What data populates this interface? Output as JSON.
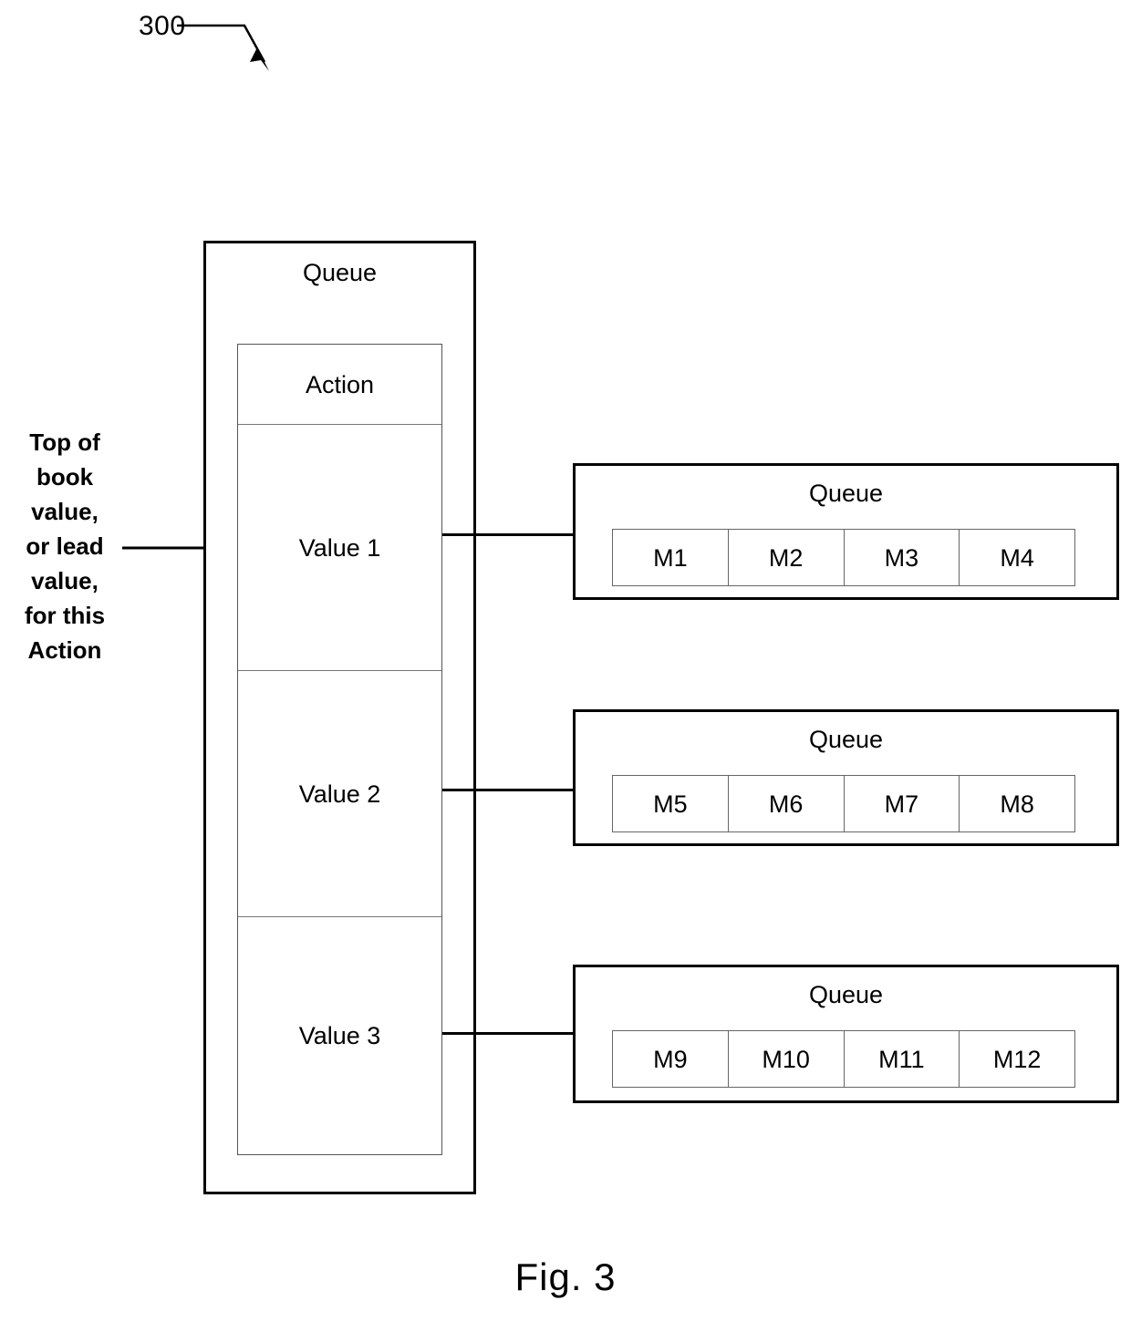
{
  "figure": {
    "reference_numeral": "300",
    "caption": "Fig. 3"
  },
  "lead_label": {
    "lines": [
      "Top of",
      "book",
      "value,",
      "or lead",
      "value,",
      "for this",
      "Action"
    ]
  },
  "main_queue": {
    "title": "Queue",
    "rows": [
      {
        "label": "Action"
      },
      {
        "label": "Value 1"
      },
      {
        "label": "Value 2"
      },
      {
        "label": "Value 3"
      }
    ]
  },
  "sub_queues": [
    {
      "title": "Queue",
      "messages": [
        "M1",
        "M2",
        "M3",
        "M4"
      ]
    },
    {
      "title": "Queue",
      "messages": [
        "M5",
        "M6",
        "M7",
        "M8"
      ]
    },
    {
      "title": "Queue",
      "messages": [
        "M9",
        "M10",
        "M11",
        "M12"
      ]
    }
  ],
  "colors": {
    "line": "#000000",
    "thin_line": "#666666",
    "background": "#ffffff"
  }
}
